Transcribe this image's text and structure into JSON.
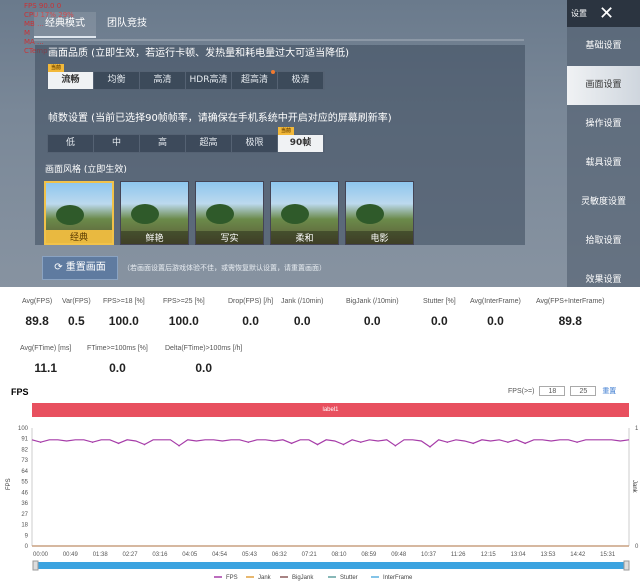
{
  "game": {
    "overlay": [
      "FPS  90.0  0",
      "CPU  17%  29%",
      "MB  ...",
      "M",
      "MA  ...",
      "CTemp ..."
    ],
    "tabs": [
      "经典模式",
      "团队竞技"
    ],
    "quality_label": "画面品质 (立即生效，若运行卡顿、发热量和耗电量过大可适当降低)",
    "quality_options": [
      "流畅",
      "均衡",
      "高清",
      "HDR高清",
      "超高清",
      "极清"
    ],
    "current_badge": "当前",
    "fps_label": "帧数设置 (当前已选择90帧帧率，请确保在手机系统中开启对应的屏幕刷新率)",
    "fps_options": [
      "低",
      "中",
      "高",
      "超高",
      "极限",
      "90帧"
    ],
    "style_label": "画面风格 (立即生效)",
    "styles": [
      "经典",
      "鲜艳",
      "写实",
      "柔和",
      "电影"
    ],
    "reset_button": "重置画面",
    "reset_note": "（若画面设置后游戏体验不佳，或需恢复默认设置，请重置画面）",
    "side_title": "设置",
    "side_items": [
      "基础设置",
      "画面设置",
      "操作设置",
      "载具设置",
      "灵敏度设置",
      "拾取设置",
      "效果设置"
    ]
  },
  "stats": [
    {
      "k": "Avg(FPS)",
      "v": "89.8"
    },
    {
      "k": "Var(FPS)",
      "v": "0.5"
    },
    {
      "k": "FPS>=18 [%]",
      "v": "100.0"
    },
    {
      "k": "FPS>=25 [%]",
      "v": "100.0"
    },
    {
      "k": "Drop(FPS) [/h]",
      "v": "0.0"
    },
    {
      "k": "Jank (/10min)",
      "v": "0.0"
    },
    {
      "k": "BigJank (/10min)",
      "v": "0.0"
    },
    {
      "k": "Stutter [%]",
      "v": "0.0"
    },
    {
      "k": "Avg(InterFrame)",
      "v": "0.0"
    },
    {
      "k": "Avg(FPS+InterFrame)",
      "v": "89.8"
    },
    {
      "k": "Avg(FTime) [ms]",
      "v": "11.1"
    },
    {
      "k": "FTime>=100ms [%]",
      "v": "0.0"
    },
    {
      "k": "Delta(FTime)>100ms [/h]",
      "v": "0.0"
    }
  ],
  "chart_data": {
    "type": "line",
    "title": "FPS",
    "label_band": "label1",
    "threshold_label": "FPS(>=)",
    "thresholds": [
      "18",
      "25"
    ],
    "reset_link": "重置",
    "ylabel": "FPS",
    "y2label": "Jank",
    "ylim": [
      0,
      100
    ],
    "y2lim": [
      0,
      1
    ],
    "yticks": [
      "100",
      "91",
      "82",
      "73",
      "64",
      "55",
      "46",
      "36",
      "27",
      "18",
      "9",
      "0"
    ],
    "y2ticks": [
      "1",
      "0"
    ],
    "xticks": [
      "00:00",
      "00:49",
      "01:38",
      "02:27",
      "03:16",
      "04:05",
      "04:54",
      "05:43",
      "06:32",
      "07:21",
      "08:10",
      "08:59",
      "09:48",
      "10:37",
      "11:26",
      "12:15",
      "13:04",
      "13:53",
      "14:42",
      "15:31"
    ],
    "legend": [
      "FPS",
      "Jank",
      "BigJank",
      "Stutter",
      "InterFrame"
    ],
    "colors": {
      "FPS": "#a63ca8",
      "Jank": "#e0a040",
      "BigJank": "#8a5a5a",
      "Stutter": "#60a0a0",
      "InterFrame": "#5ab0e0"
    },
    "fps": [
      90,
      88,
      90,
      90,
      89,
      90,
      90,
      88,
      90,
      90,
      87,
      90,
      89,
      86,
      90,
      90,
      90,
      85,
      90,
      89,
      90,
      90,
      89,
      90,
      90,
      88,
      90,
      90,
      89,
      90,
      87,
      90,
      90,
      86,
      90,
      89,
      86,
      90,
      88,
      90,
      89,
      90,
      85,
      90,
      90,
      89,
      84,
      90,
      88,
      90,
      89,
      87,
      90,
      89,
      90,
      88,
      90,
      87,
      90,
      90,
      89,
      90,
      90,
      88,
      90,
      90,
      90,
      90,
      89,
      90
    ]
  }
}
